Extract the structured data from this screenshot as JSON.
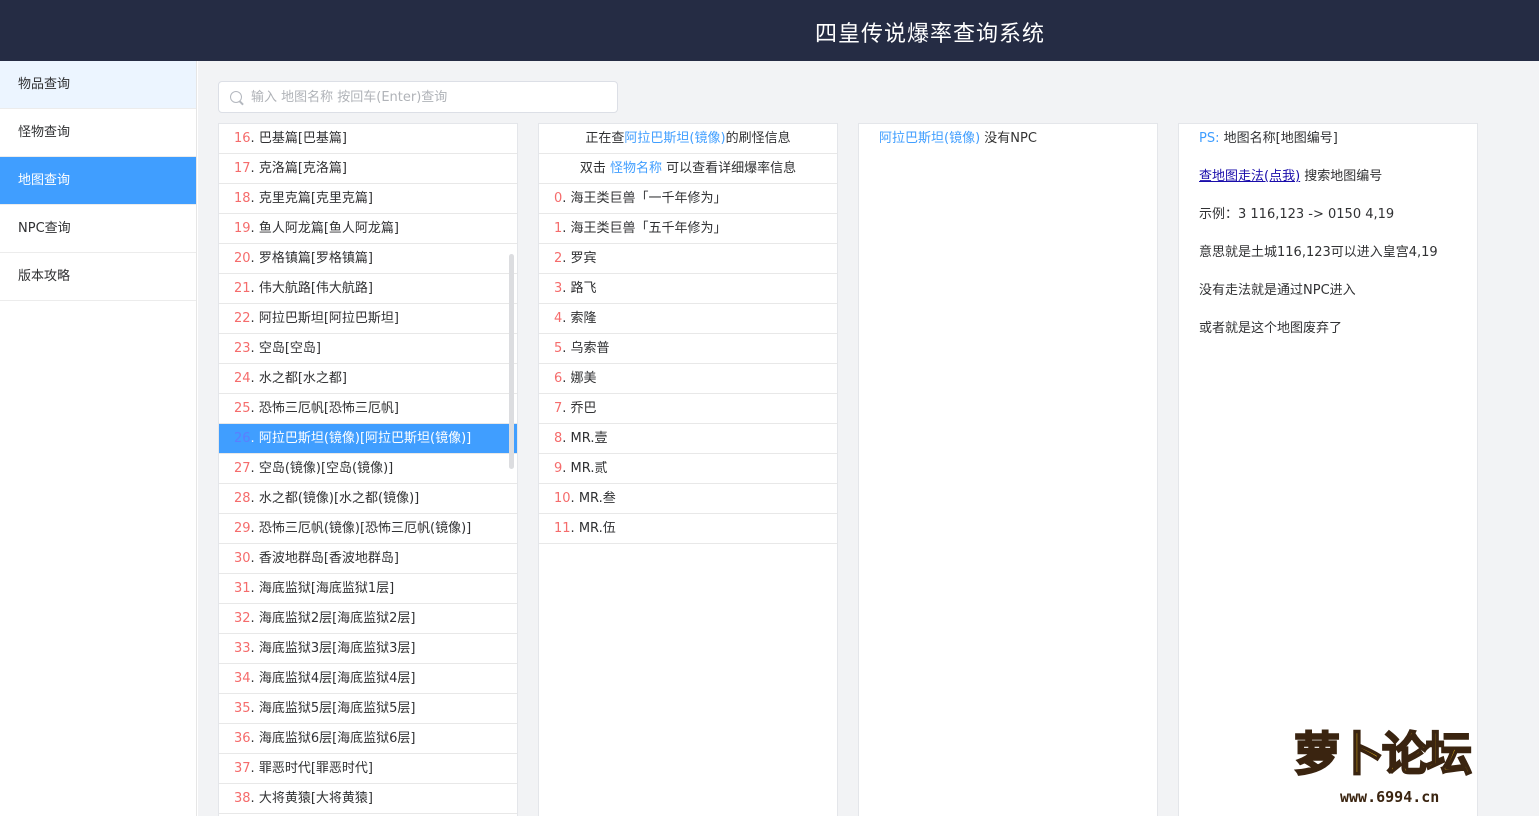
{
  "header": {
    "title": "四皇传说爆率查询系统"
  },
  "sidebar": {
    "items": [
      {
        "label": "物品查询",
        "state": "hover"
      },
      {
        "label": "怪物查询",
        "state": ""
      },
      {
        "label": "地图查询",
        "state": "active"
      },
      {
        "label": "NPC查询",
        "state": ""
      },
      {
        "label": "版本攻略",
        "state": ""
      }
    ]
  },
  "search": {
    "placeholder": "输入 地图名称 按回车(Enter)查询",
    "value": ""
  },
  "maps": [
    {
      "num": "16",
      "label": "巴基篇[巴基篇]"
    },
    {
      "num": "17",
      "label": "克洛篇[克洛篇]"
    },
    {
      "num": "18",
      "label": "克里克篇[克里克篇]"
    },
    {
      "num": "19",
      "label": "鱼人阿龙篇[鱼人阿龙篇]"
    },
    {
      "num": "20",
      "label": "罗格镇篇[罗格镇篇]"
    },
    {
      "num": "21",
      "label": "伟大航路[伟大航路]"
    },
    {
      "num": "22",
      "label": "阿拉巴斯坦[阿拉巴斯坦]"
    },
    {
      "num": "23",
      "label": "空岛[空岛]"
    },
    {
      "num": "24",
      "label": "水之都[水之都]"
    },
    {
      "num": "25",
      "label": "恐怖三厄帆[恐怖三厄帆]"
    },
    {
      "num": "26",
      "label": "阿拉巴斯坦(镜像)[阿拉巴斯坦(镜像)]",
      "selected": true
    },
    {
      "num": "27",
      "label": "空岛(镜像)[空岛(镜像)]"
    },
    {
      "num": "28",
      "label": "水之都(镜像)[水之都(镜像)]"
    },
    {
      "num": "29",
      "label": "恐怖三厄帆(镜像)[恐怖三厄帆(镜像)]"
    },
    {
      "num": "30",
      "label": "香波地群岛[香波地群岛]"
    },
    {
      "num": "31",
      "label": "海底监狱[海底监狱1层]"
    },
    {
      "num": "32",
      "label": "海底监狱2层[海底监狱2层]"
    },
    {
      "num": "33",
      "label": "海底监狱3层[海底监狱3层]"
    },
    {
      "num": "34",
      "label": "海底监狱4层[海底监狱4层]"
    },
    {
      "num": "35",
      "label": "海底监狱5层[海底监狱5层]"
    },
    {
      "num": "36",
      "label": "海底监狱6层[海底监狱6层]"
    },
    {
      "num": "37",
      "label": "罪恶时代[罪恶时代]"
    },
    {
      "num": "38",
      "label": "大将黄猿[大将黄猿]"
    }
  ],
  "monsters": {
    "header1_prefix": "正在查",
    "header1_map": "阿拉巴斯坦(镜像)",
    "header1_suffix": "的刷怪信息",
    "header2_prefix": "双击",
    "header2_link": "怪物名称",
    "header2_suffix": "可以查看详细爆率信息",
    "list": [
      {
        "num": "0",
        "label": "海王类巨兽「一千年修为」"
      },
      {
        "num": "1",
        "label": "海王类巨兽「五千年修为」"
      },
      {
        "num": "2",
        "label": "罗宾"
      },
      {
        "num": "3",
        "label": "路飞"
      },
      {
        "num": "4",
        "label": "索隆"
      },
      {
        "num": "5",
        "label": "乌索普"
      },
      {
        "num": "6",
        "label": "娜美"
      },
      {
        "num": "7",
        "label": "乔巴"
      },
      {
        "num": "8",
        "label": "MR.壹"
      },
      {
        "num": "9",
        "label": "MR.贰"
      },
      {
        "num": "10",
        "label": "MR.叁"
      },
      {
        "num": "11",
        "label": "MR.伍"
      }
    ]
  },
  "npc": {
    "map": "阿拉巴斯坦(镜像)",
    "text": "没有NPC"
  },
  "help": {
    "ps_label": "PS:",
    "ps_text": "地图名称[地图编号]",
    "link": "查地图走法(点我)",
    "link_suffix": "搜索地图编号",
    "example": "示例：3 116,123 -> 0150 4,19",
    "meaning": "意思就是土城116,123可以进入皇宫4,19",
    "npc_note": "没有走法就是通过NPC进入",
    "abandoned": "或者就是这个地图废弃了"
  },
  "watermark": {
    "text": "萝卜论坛",
    "url": "www.6994.cn"
  },
  "colors": {
    "header_bg": "#252c44",
    "accent": "#409eff",
    "number_red": "#f56c6c",
    "link": "#1a0dab"
  }
}
